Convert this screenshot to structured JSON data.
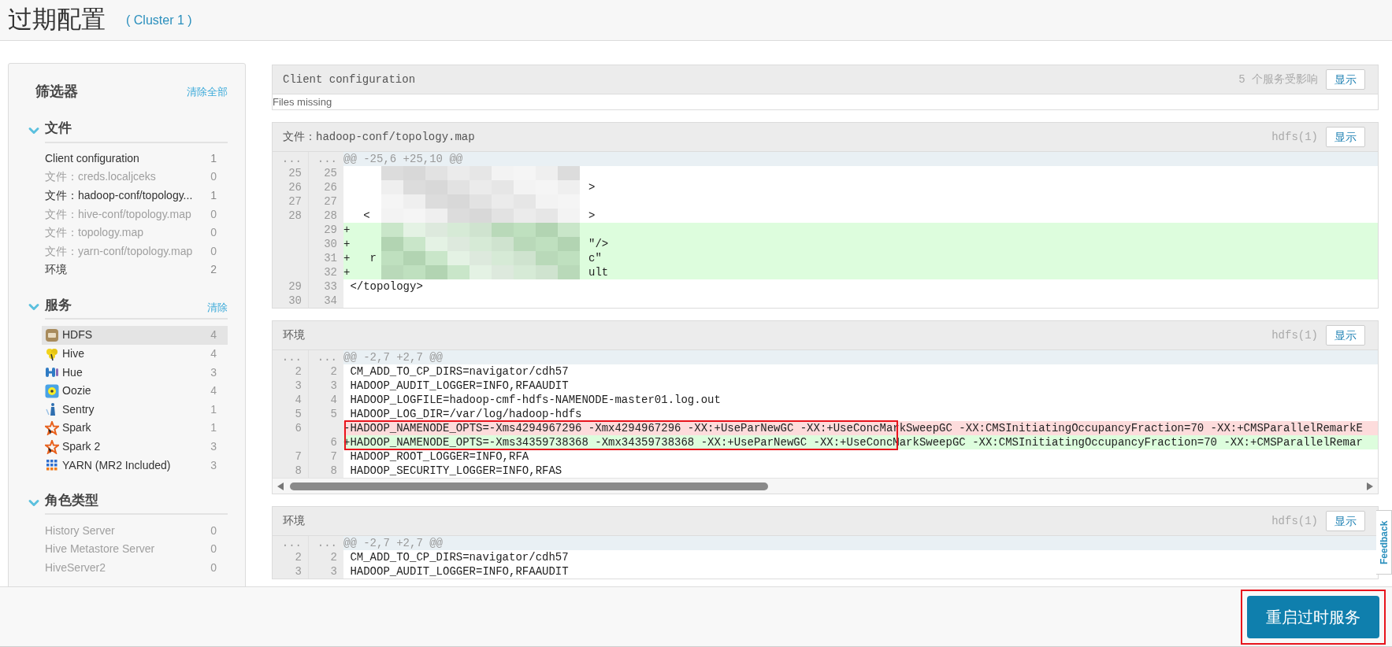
{
  "header": {
    "title": "过期配置",
    "cluster_link": "( Cluster 1 )"
  },
  "filters": {
    "title": "筛选器",
    "clear_all": "清除全部",
    "sections": [
      {
        "title": "文件",
        "expanded": true,
        "items": [
          {
            "label": "Client configuration",
            "count": "1",
            "disabled": false
          },
          {
            "label": "文件：creds.localjceks",
            "count": "0",
            "disabled": true
          },
          {
            "label": "文件：hadoop-conf/topology...",
            "count": "1",
            "disabled": false
          },
          {
            "label": "文件：hive-conf/topology.map",
            "count": "0",
            "disabled": true
          },
          {
            "label": "文件：topology.map",
            "count": "0",
            "disabled": true
          },
          {
            "label": "文件：yarn-conf/topology.map",
            "count": "0",
            "disabled": true
          },
          {
            "label": "环境",
            "count": "2",
            "disabled": false
          }
        ]
      },
      {
        "title": "服务",
        "expanded": true,
        "clear": "清除",
        "items": [
          {
            "label": "HDFS",
            "count": "4",
            "selected": true
          },
          {
            "label": "Hive",
            "count": "4",
            "selected": false
          },
          {
            "label": "Hue",
            "count": "3",
            "selected": false
          },
          {
            "label": "Oozie",
            "count": "4",
            "selected": false
          },
          {
            "label": "Sentry",
            "count": "1",
            "selected": false
          },
          {
            "label": "Spark",
            "count": "1",
            "selected": false
          },
          {
            "label": "Spark 2",
            "count": "3",
            "selected": false
          },
          {
            "label": "YARN (MR2 Included)",
            "count": "3",
            "selected": false
          }
        ]
      },
      {
        "title": "角色类型",
        "expanded": true,
        "items": [
          {
            "label": "History Server",
            "count": "0",
            "disabled": true
          },
          {
            "label": "Hive Metastore Server",
            "count": "0",
            "disabled": true
          },
          {
            "label": "HiveServer2",
            "count": "0",
            "disabled": true
          }
        ]
      }
    ]
  },
  "panels": [
    {
      "title": "Client configuration",
      "affected": "5 个服务受影响",
      "button": "显示",
      "message": "Files missing"
    },
    {
      "title": "文件：hadoop-conf/topology.map",
      "affected": "hdfs(1)",
      "button": "显示",
      "diff": {
        "rows": [
          {
            "kind": "hunk",
            "old": "...",
            "new": "...",
            "text": "@@ -25,6 +25,10 @@"
          },
          {
            "kind": "context",
            "old": "25",
            "new": "25",
            "redacted": true
          },
          {
            "kind": "context",
            "old": "26",
            "new": "26",
            "redacted": true,
            "tail": ">"
          },
          {
            "kind": "context",
            "old": "27",
            "new": "27",
            "redacted": true
          },
          {
            "kind": "context",
            "old": "28",
            "new": "28",
            "redacted": true,
            "text": "  <",
            "tail": ">"
          },
          {
            "kind": "added",
            "new": "29",
            "redacted": true,
            "text": "+"
          },
          {
            "kind": "added",
            "new": "30",
            "redacted": true,
            "text": "+",
            "tail": "\"/>"
          },
          {
            "kind": "added",
            "new": "31",
            "redacted": true,
            "text": "+   r",
            "tail": "c\""
          },
          {
            "kind": "added",
            "new": "32",
            "redacted": true,
            "text": "+",
            "tail": "ult"
          },
          {
            "kind": "context",
            "old": "29",
            "new": "33",
            "text": "</topology>"
          },
          {
            "kind": "context",
            "old": "30",
            "new": "34"
          }
        ]
      }
    },
    {
      "title": "环境",
      "affected": "hdfs(1)",
      "button": "显示",
      "scrollbar": true,
      "diff": {
        "rows": [
          {
            "kind": "hunk",
            "old": "...",
            "new": "...",
            "text": "@@ -2,7 +2,7 @@",
            "highlighted": false
          },
          {
            "kind": "context",
            "old": "2",
            "new": "2",
            "text": "CM_ADD_TO_CP_DIRS=navigator/cdh57",
            "highlighted": false
          },
          {
            "kind": "context",
            "old": "3",
            "new": "3",
            "text": "HADOOP_AUDIT_LOGGER=INFO,RFAAUDIT",
            "highlighted": false
          },
          {
            "kind": "context",
            "old": "4",
            "new": "4",
            "text": "HADOOP_LOGFILE=hadoop-cmf-hdfs-NAMENODE-master01.log.out",
            "highlighted": false
          },
          {
            "kind": "context",
            "old": "5",
            "new": "5",
            "text": "HADOOP_LOG_DIR=/var/log/hadoop-hdfs",
            "highlighted": false
          },
          {
            "kind": "removed",
            "old": "6",
            "text": "-HADOOP_NAMENODE_OPTS=-Xms4294967296 -Xmx4294967296 -XX:+UseParNewGC -XX:+UseConcMarkSweepGC -XX:CMSInitiatingOccupancyFraction=70 -XX:+CMSParallelRemarkE",
            "highlighted": true
          },
          {
            "kind": "added",
            "new": "6",
            "text": "+HADOOP_NAMENODE_OPTS=-Xms34359738368 -Xmx34359738368 -XX:+UseParNewGC -XX:+UseConcMarkSweepGC -XX:CMSInitiatingOccupancyFraction=70 -XX:+CMSParallelRemar",
            "highlighted": true
          },
          {
            "kind": "context",
            "old": "7",
            "new": "7",
            "text": "HADOOP_ROOT_LOGGER=INFO,RFA",
            "highlighted": false
          },
          {
            "kind": "context",
            "old": "8",
            "new": "8",
            "text": "HADOOP_SECURITY_LOGGER=INFO,RFAS",
            "highlighted": false
          }
        ]
      }
    },
    {
      "title": "环境",
      "affected": "hdfs(1)",
      "button": "显示",
      "diff": {
        "rows": [
          {
            "kind": "hunk",
            "old": "...",
            "new": "...",
            "text": "@@ -2,7 +2,7 @@"
          },
          {
            "kind": "context",
            "old": "2",
            "new": "2",
            "text": "CM_ADD_TO_CP_DIRS=navigator/cdh57"
          },
          {
            "kind": "context",
            "old": "3",
            "new": "3",
            "text": "HADOOP_AUDIT_LOGGER=INFO,RFAAUDIT"
          }
        ]
      }
    }
  ],
  "feedback": "Feedback",
  "footer": {
    "button": "重启过时服务",
    "highlighted": true
  }
}
